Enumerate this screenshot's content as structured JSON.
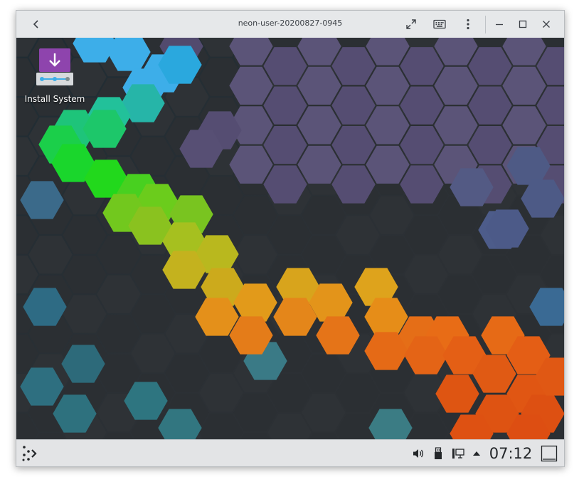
{
  "window": {
    "title": "neon-user-20200827-0945",
    "buttons": {
      "back": "back-icon",
      "fullscreen": "expand-icon",
      "keyboard": "keyboard-icon",
      "menu": "kebab-menu-icon",
      "minimize": "minimize-icon",
      "maximize": "maximize-icon",
      "close": "close-icon"
    }
  },
  "desktop": {
    "icons": [
      {
        "label": "Install System",
        "icon": "install-system-icon"
      }
    ]
  },
  "panel": {
    "launcher_icon": "application-launcher-icon",
    "tray": [
      "volume-icon",
      "usb-device-icon",
      "network-icon",
      "expand-tray-icon"
    ],
    "clock": "07:12",
    "show_desktop_icon": "show-desktop-icon"
  },
  "colors": {
    "titlebar": "#e6e8ea",
    "panel": "#eff0f1",
    "purple": "#8e44ad",
    "wall_dark": "#2a2e32"
  }
}
